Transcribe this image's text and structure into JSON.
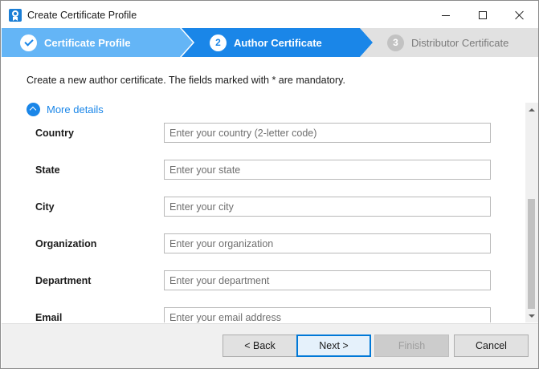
{
  "window": {
    "title": "Create Certificate Profile"
  },
  "stepper": {
    "steps": [
      {
        "number": "",
        "label": "Certificate Profile",
        "state": "completed"
      },
      {
        "number": "2",
        "label": "Author Certificate",
        "state": "active"
      },
      {
        "number": "3",
        "label": "Distributor Certificate",
        "state": "pending"
      }
    ]
  },
  "instruction": "Create a new author certificate. The fields marked with * are mandatory.",
  "more_details": {
    "label": "More details",
    "expanded": true
  },
  "form": {
    "fields": [
      {
        "label": "Country",
        "value": "",
        "placeholder": "Enter your country (2-letter code)"
      },
      {
        "label": "State",
        "value": "",
        "placeholder": "Enter your state"
      },
      {
        "label": "City",
        "value": "",
        "placeholder": "Enter your city"
      },
      {
        "label": "Organization",
        "value": "",
        "placeholder": "Enter your organization"
      },
      {
        "label": "Department",
        "value": "",
        "placeholder": "Enter your department"
      },
      {
        "label": "Email",
        "value": "",
        "placeholder": "Enter your email address"
      }
    ]
  },
  "buttons": {
    "back": "< Back",
    "next": "Next >",
    "finish": "Finish",
    "cancel": "Cancel"
  },
  "colors": {
    "accent": "#1a86e8",
    "step_completed": "#64b5f6",
    "step_pending": "#e1e1e1"
  }
}
